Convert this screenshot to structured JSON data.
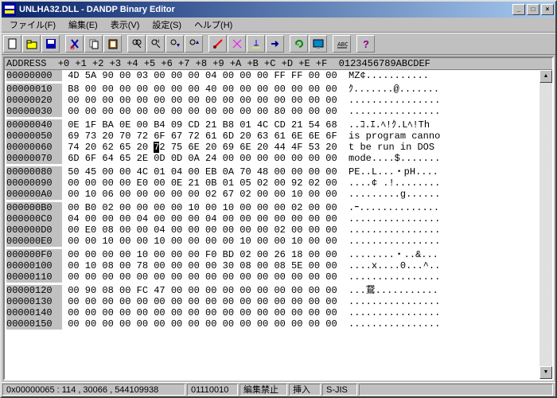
{
  "window": {
    "title": "UNLHA32.DLL - DANDP Binary Editor"
  },
  "menu": {
    "file": "ファイル(F)",
    "edit": "編集(E)",
    "view": "表示(V)",
    "settings": "設定(S)",
    "help": "ヘルプ(H)"
  },
  "header": "ADDRESS  +0 +1 +2 +3 +4 +5 +6 +7 +8 +9 +A +B +C +D +E +F  0123456789ABCDEF",
  "rows": [
    {
      "a": "00000000",
      "h": "4D 5A 90 00 03 00 00 00 04 00 00 00 FF FF 00 00",
      "t": "MZ¢..........."
    },
    {
      "a": "00000010",
      "h": "B8 00 00 00 00 00 00 00 40 00 00 00 00 00 00 00",
      "t": "ｸ.......@......."
    },
    {
      "a": "00000020",
      "h": "00 00 00 00 00 00 00 00 00 00 00 00 00 00 00 00",
      "t": "................"
    },
    {
      "a": "00000030",
      "h": "00 00 00 00 00 00 00 00 00 00 00 00 80 00 00 00",
      "t": "................"
    },
    {
      "a": "00000040",
      "h": "0E 1F BA 0E 00 B4 09 CD 21 B8 01 4C CD 21 54 68",
      "t": "..ｺ.ｴ.ﾍ!ｸ.Lﾍ!Th"
    },
    {
      "a": "00000050",
      "h": "69 73 20 70 72 6F 67 72 61 6D 20 63 61 6E 6E 6F",
      "t": "is program canno"
    },
    {
      "a": "00000060",
      "h": "74 20 62 65 20 72 75 6E 20 69 6E 20 44 4F 53 20",
      "t": "t be run in DOS ",
      "cursor": 5
    },
    {
      "a": "00000070",
      "h": "6D 6F 64 65 2E 0D 0D 0A 24 00 00 00 00 00 00 00",
      "t": "mode....$......."
    },
    {
      "a": "00000080",
      "h": "50 45 00 00 4C 01 04 00 EB 0A 70 48 00 00 00 00",
      "t": "PE..L...・pH...."
    },
    {
      "a": "00000090",
      "h": "00 00 00 00 E0 00 0E 21 0B 01 05 02 00 92 02 00",
      "t": "....¢ .!........"
    },
    {
      "a": "000000A0",
      "h": "00 10 06 00 00 00 00 00 02 67 02 00 00 10 00 00",
      "t": ".........g......"
    },
    {
      "a": "000000B0",
      "h": "00 B0 02 00 00 00 00 10 00 10 00 00 00 02 00 00",
      "t": ".ｰ.............."
    },
    {
      "a": "000000C0",
      "h": "04 00 00 00 04 00 00 00 04 00 00 00 00 00 00 00",
      "t": "................"
    },
    {
      "a": "000000D0",
      "h": "00 E0 08 00 00 04 00 00 00 00 00 00 02 00 00 00",
      "t": "................"
    },
    {
      "a": "000000E0",
      "h": "00 00 10 00 00 10 00 00 00 00 10 00 00 10 00 00",
      "t": "................"
    },
    {
      "a": "000000F0",
      "h": "00 00 00 00 10 00 00 00 F0 BD 02 00 26 18 00 00",
      "t": "........・..&..."
    },
    {
      "a": "00000100",
      "h": "00 10 08 00 78 00 00 00 00 30 08 00 08 5E 00 00",
      "t": "....x....0...^.."
    },
    {
      "a": "00000110",
      "h": "00 00 00 00 00 00 00 00 00 00 00 00 00 00 00 00",
      "t": "................"
    },
    {
      "a": "00000120",
      "h": "00 90 08 00 FC 47 00 00 00 00 00 00 00 00 00 00",
      "t": "...鵞..........."
    },
    {
      "a": "00000130",
      "h": "00 00 00 00 00 00 00 00 00 00 00 00 00 00 00 00",
      "t": "................"
    },
    {
      "a": "00000140",
      "h": "00 00 00 00 00 00 00 00 00 00 00 00 00 00 00 00",
      "t": "................"
    },
    {
      "a": "00000150",
      "h": "00 00 00 00 00 00 00 00 00 00 00 00 00 00 00 00",
      "t": "................"
    }
  ],
  "status": {
    "pos": "0x00000065 : 114 , 30066 , 544109938",
    "bits": "01110010",
    "mode": "編集禁止",
    "insert": "挿入",
    "encoding": "S-JIS"
  }
}
